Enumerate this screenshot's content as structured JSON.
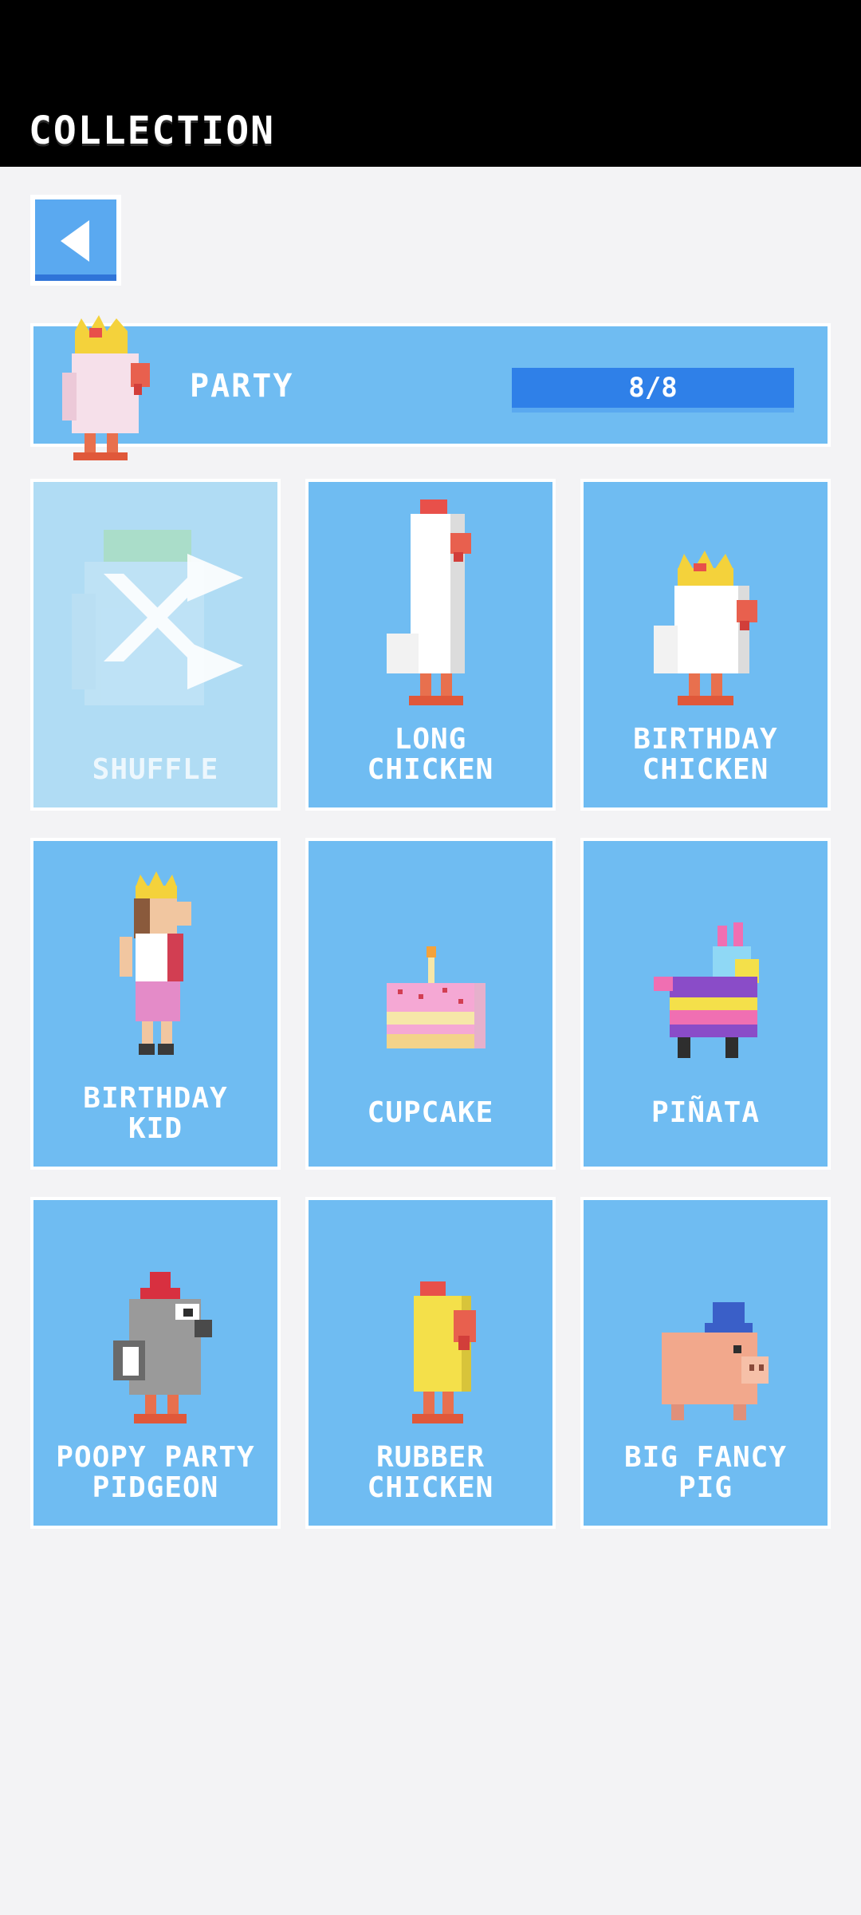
{
  "header": {
    "title": "COLLECTION"
  },
  "back_button": {
    "icon": "back-arrow-icon"
  },
  "banner": {
    "label": "PARTY",
    "progress_text": "8/8",
    "progress_fraction": 1.0
  },
  "cards": [
    {
      "label": "SHUFFLE",
      "icon": "shuffle-icon"
    },
    {
      "label": "LONG\nCHICKEN",
      "icon": "long-chicken-icon"
    },
    {
      "label": "BIRTHDAY\nCHICKEN",
      "icon": "birthday-chicken-icon"
    },
    {
      "label": "BIRTHDAY\nKID",
      "icon": "birthday-kid-icon"
    },
    {
      "label": "CUPCAKE",
      "icon": "cupcake-icon"
    },
    {
      "label": "PIÑATA",
      "icon": "pinata-icon"
    },
    {
      "label": "POOPY PARTY\nPIDGEON",
      "icon": "poopy-party-pidgeon-icon"
    },
    {
      "label": "RUBBER\nCHICKEN",
      "icon": "rubber-chicken-icon"
    },
    {
      "label": "BIG FANCY\nPIG",
      "icon": "big-fancy-pig-icon"
    }
  ]
}
